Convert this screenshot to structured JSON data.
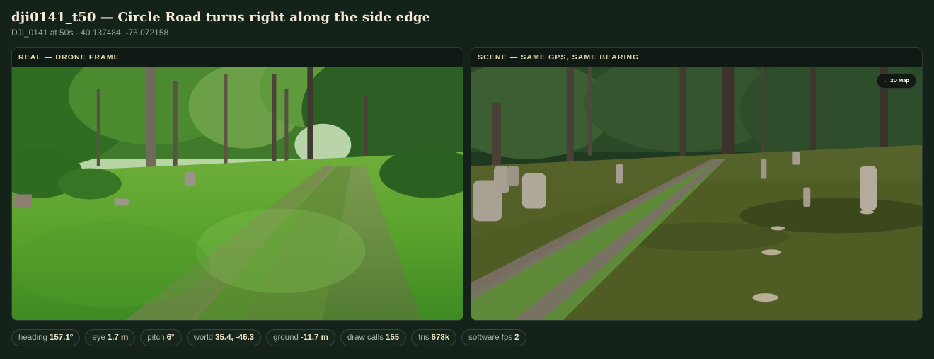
{
  "header": {
    "title": "dji0141_t50 — Circle Road turns right along the side edge",
    "subtitle": "DJI_0141 at 50s · 40.137484, -75.072158"
  },
  "panels": {
    "real": {
      "label": "REAL — DRONE FRAME"
    },
    "scene": {
      "label": "SCENE — SAME GPS, SAME BEARING",
      "map_button": "← 2D Map"
    }
  },
  "stats": [
    {
      "label": "heading",
      "value": "157.1°"
    },
    {
      "label": "eye",
      "value": "1.7 m"
    },
    {
      "label": "pitch",
      "value": "6°"
    },
    {
      "label": "world",
      "value": "35.4, -46.3"
    },
    {
      "label": "ground",
      "value": "-11.7 m"
    },
    {
      "label": "draw calls",
      "value": "155"
    },
    {
      "label": "tris",
      "value": "678k"
    },
    {
      "label": "software fps",
      "value": "2"
    }
  ],
  "colors": {
    "background": "#142219",
    "accent": "#e6d6a8",
    "title": "#f3ead7"
  }
}
